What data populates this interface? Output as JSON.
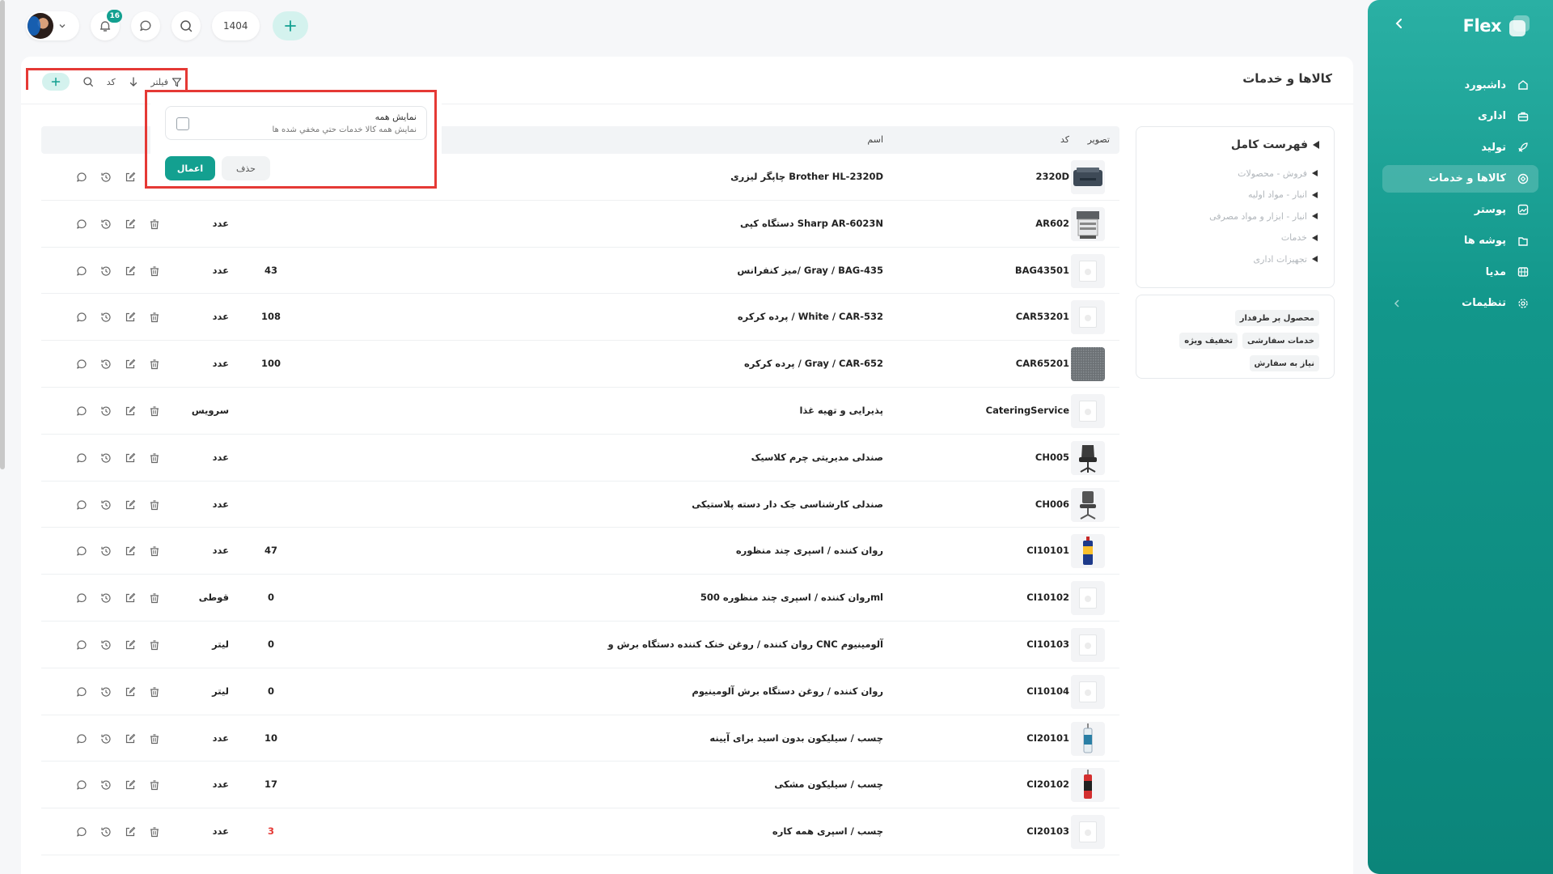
{
  "sidebar": {
    "brand": "Flex",
    "items": [
      {
        "label": "داشبورد",
        "icon": "home-icon",
        "active": false
      },
      {
        "label": "اداری",
        "icon": "briefcase-icon",
        "active": false
      },
      {
        "label": "تولید",
        "icon": "rocket-icon",
        "active": false
      },
      {
        "label": "کالاها و خدمات",
        "icon": "box-icon",
        "active": true
      },
      {
        "label": "پوستر",
        "icon": "image-icon",
        "active": false
      },
      {
        "label": "پوشه ها",
        "icon": "folder-icon",
        "active": false
      },
      {
        "label": "مدیا",
        "icon": "film-icon",
        "active": false
      },
      {
        "label": "تنظیمات",
        "icon": "gear-icon",
        "active": false
      }
    ]
  },
  "topbar": {
    "notifications_count": "16",
    "year": "1404"
  },
  "page": {
    "title": "کالاها و خدمات"
  },
  "toolbar": {
    "filter_label": "فیلتر",
    "code_label": "کد"
  },
  "filter_popup": {
    "show_all_title": "نمایش همه",
    "show_all_desc": "نمایش همه کالا خدمات حتي مخفي شده ها",
    "show_all_checked": false,
    "apply_label": "اعمال",
    "remove_label": "حذف"
  },
  "categories": {
    "title": "فهرست کامل",
    "items": [
      "فروش - محصولات",
      "انبار - مواد اولیه",
      "انبار - ابزار و مواد مصرفی",
      "خدمات",
      "تجهیزات اداری"
    ]
  },
  "tags": [
    "محصول پر طرفدار",
    "خدمات سفارشی",
    "تخفیف ویژه",
    "نیاز به سفارش"
  ],
  "table": {
    "headers": {
      "image": "تصویر",
      "code": "کد",
      "name": "اسم"
    },
    "rows": [
      {
        "code": "2320D",
        "name": "چاپگر لیزری Brother HL-2320D",
        "qty": "",
        "unit": "",
        "thumb": "printer"
      },
      {
        "code": "AR602",
        "name": "دستگاه کپی Sharp AR-6023N",
        "qty": "",
        "unit": "عدد",
        "thumb": "copier"
      },
      {
        "code": "BAG43501",
        "name": "میز کنفرانس/ Gray / BAG-435",
        "qty": "43",
        "unit": "عدد",
        "thumb": "placeholder"
      },
      {
        "code": "CAR53201",
        "name": "پرده کرکره / White / CAR-532",
        "qty": "108",
        "unit": "عدد",
        "thumb": "placeholder"
      },
      {
        "code": "CAR65201",
        "name": "پرده کرکره / Gray / CAR-652",
        "qty": "100",
        "unit": "عدد",
        "thumb": "fabric"
      },
      {
        "code": "CateringService",
        "name": "پذیرایی و تهیه غذا",
        "qty": "",
        "unit": "سرویس",
        "thumb": "placeholder"
      },
      {
        "code": "CH005",
        "name": "صندلی مدیریتی چرم کلاسیک",
        "qty": "",
        "unit": "عدد",
        "thumb": "chair"
      },
      {
        "code": "CH006",
        "name": "صندلی کارشناسی جک دار دسته پلاستیکی",
        "qty": "",
        "unit": "عدد",
        "thumb": "chair2"
      },
      {
        "code": "CI10101",
        "name": "روان کننده / اسپری چند منظوره",
        "qty": "47",
        "unit": "عدد",
        "thumb": "spray"
      },
      {
        "code": "CI10102",
        "name": "روان کننده / اسپری چند منظوره 500ml",
        "qty": "0",
        "unit": "قوطی",
        "thumb": "placeholder"
      },
      {
        "code": "CI10103",
        "name": "روان کننده / روغن خنک کننده دستگاه برش و CNC آلومینیوم",
        "qty": "0",
        "unit": "لیتر",
        "thumb": "placeholder"
      },
      {
        "code": "CI10104",
        "name": "روان کننده / روغن دستگاه برش آلومینیوم",
        "qty": "0",
        "unit": "لیتر",
        "thumb": "placeholder"
      },
      {
        "code": "CI20101",
        "name": "چسب / سیلیکون بدون اسید برای آیینه",
        "qty": "10",
        "unit": "عدد",
        "thumb": "tube"
      },
      {
        "code": "CI20102",
        "name": "چسب / سیلیکون مشکی",
        "qty": "17",
        "unit": "عدد",
        "thumb": "tube2"
      },
      {
        "code": "CI20103",
        "name": "چسب / اسپری همه کاره",
        "qty": "3",
        "unit": "عدد",
        "thumb": "placeholder",
        "qty_alert": true
      }
    ]
  },
  "colors": {
    "accent": "#13a090",
    "sidebar": "#12978b",
    "highlight": "#e53935"
  }
}
